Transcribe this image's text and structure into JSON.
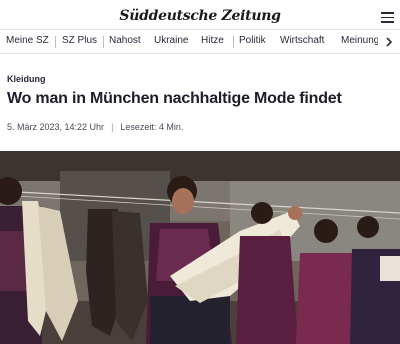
{
  "header": {
    "logo_text": "Süddeutsche Zeitung",
    "menu_icon": "hamburger-menu-icon"
  },
  "nav": {
    "items": [
      {
        "label": "Meine SZ"
      },
      {
        "label": "SZ Plus"
      },
      {
        "label": "Nahost"
      },
      {
        "label": "Ukraine"
      },
      {
        "label": "Hitze"
      },
      {
        "label": "Politik"
      },
      {
        "label": "Wirtschaft"
      },
      {
        "label": "Meinung"
      }
    ],
    "next_icon": "chevron-right-icon"
  },
  "article": {
    "kicker": "Kleidung",
    "headline": "Wo man in München nachhaltige Mode findet",
    "date": "5. März 2023, 14:22 Uhr",
    "separator": "|",
    "reading_time": "Lesezeit: 4 Min."
  },
  "colors": {
    "text": "#29293a",
    "divider": "#e4e4e4"
  }
}
